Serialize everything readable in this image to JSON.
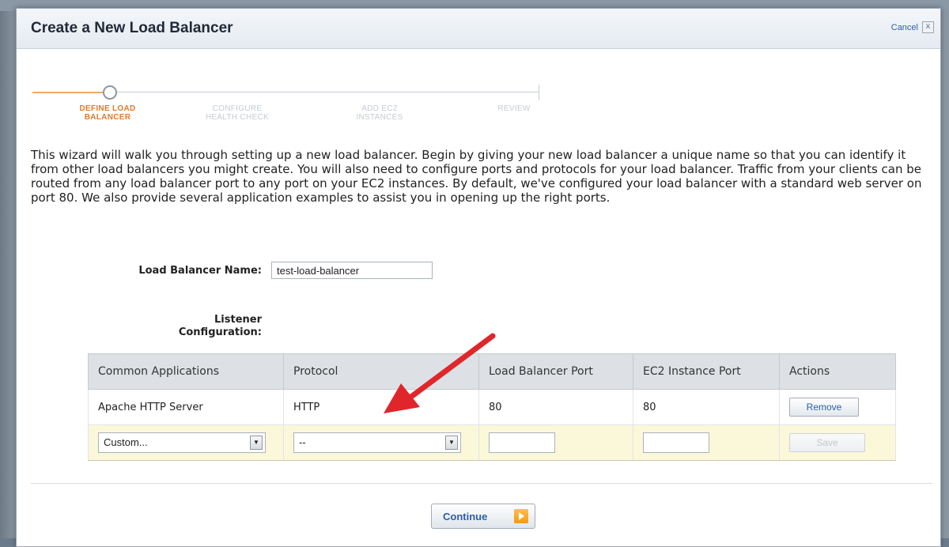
{
  "dialog": {
    "title": "Create a New Load Balancer",
    "cancel_label": "Cancel",
    "close_glyph": "x"
  },
  "wizard": {
    "steps": [
      {
        "label_line1": "DEFINE LOAD",
        "label_line2": "BALANCER",
        "active": true
      },
      {
        "label_line1": "CONFIGURE",
        "label_line2": "HEALTH CHECK",
        "active": false
      },
      {
        "label_line1": "ADD EC2",
        "label_line2": "INSTANCES",
        "active": false
      },
      {
        "label_line1": "REVIEW",
        "label_line2": "",
        "active": false
      }
    ]
  },
  "intro_text": "This wizard will walk you through setting up a new load balancer. Begin by giving your new load balancer a unique name so that you can identify it from other load balancers you might create. You will also need to configure ports and protocols for your load balancer. Traffic from your clients can be routed from any load balancer port to any port on your EC2 instances. By default, we've configured your load balancer with a standard web server on port 80. We also provide several application examples to assist you in opening up the right ports.",
  "form": {
    "name_label": "Load Balancer Name:",
    "name_value": "test-load-balancer",
    "listener_label_line1": "Listener",
    "listener_label_line2": "Configuration:"
  },
  "listener_table": {
    "headers": [
      "Common Applications",
      "Protocol",
      "Load Balancer Port",
      "EC2 Instance Port",
      "Actions"
    ],
    "row": {
      "application": "Apache HTTP Server",
      "protocol": "HTTP",
      "lb_port": "80",
      "instance_port": "80",
      "action": "Remove"
    },
    "new_row": {
      "application_select": "Custom...",
      "protocol_select": "--",
      "save_label": "Save",
      "dropdown_glyph": "▼"
    }
  },
  "footer": {
    "continue_label": "Continue"
  },
  "colors": {
    "accent_orange": "#e07a2c",
    "link_blue": "#2a5fa8",
    "annotation_arrow": "#e0262a",
    "new_row_bg": "#fbf7d9"
  }
}
